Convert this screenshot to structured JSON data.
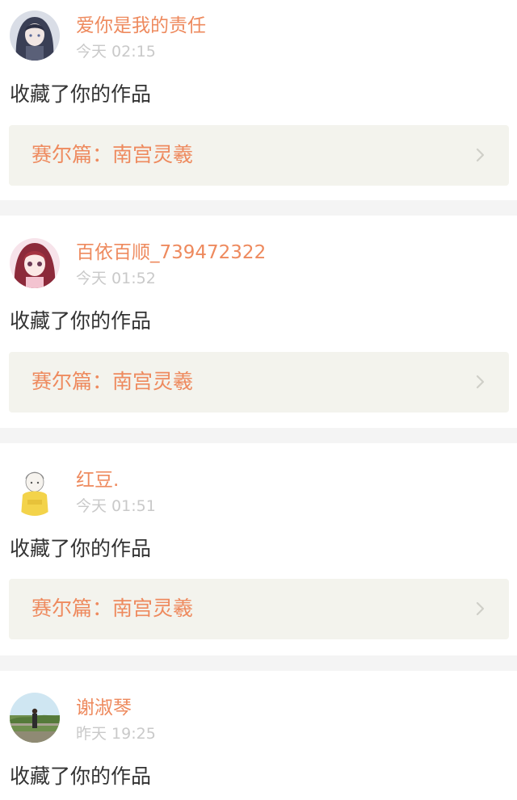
{
  "colors": {
    "accent": "#ee8a5e",
    "muted": "#c9c9c9",
    "text": "#333333",
    "card_bg": "#f3f3ed",
    "separator": "#f4f4f4"
  },
  "notifications": [
    {
      "user": "爱你是我的责任",
      "time": "今天 02:15",
      "action": "收藏了你的作品",
      "work": "赛尔篇：南宫灵羲",
      "avatar_icon": "anime-dark-hair-avatar"
    },
    {
      "user": "百依百顺_739472322",
      "time": "今天 01:52",
      "action": "收藏了你的作品",
      "work": "赛尔篇：南宫灵羲",
      "avatar_icon": "anime-girl-red-hair-avatar"
    },
    {
      "user": "红豆.",
      "time": "今天 01:51",
      "action": "收藏了你的作品",
      "work": "赛尔篇：南宫灵羲",
      "avatar_icon": "yellow-sweater-sketch-avatar"
    },
    {
      "user": "谢淑琴",
      "time": "昨天 19:25",
      "action": "收藏了你的作品",
      "avatar_icon": "landscape-photo-avatar"
    }
  ]
}
